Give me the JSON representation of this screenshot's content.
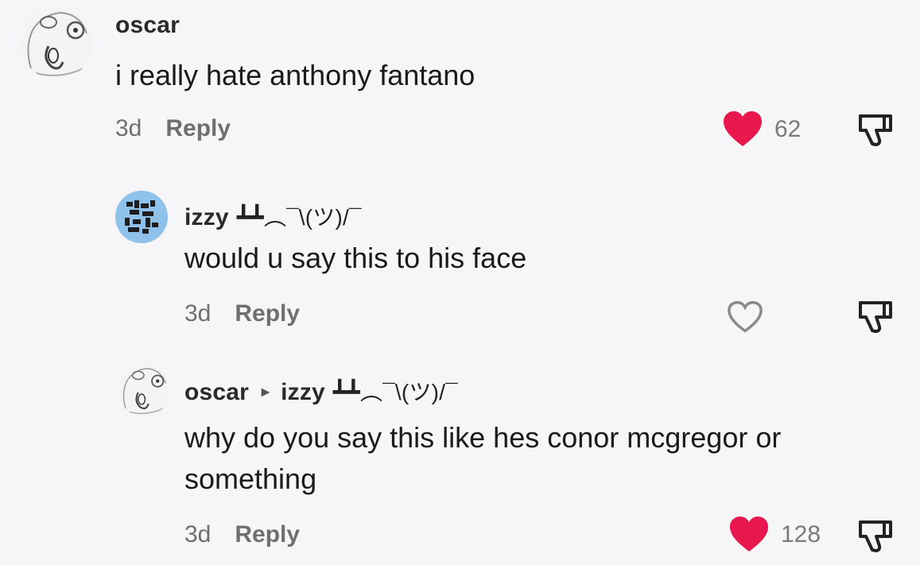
{
  "comments": [
    {
      "username": "oscar",
      "text": "i really hate anthony fantano",
      "time": "3d",
      "reply_label": "Reply",
      "liked": true,
      "like_count": "62"
    },
    {
      "username": "izzy",
      "username_suffix": "┻┻︵¯\\(ツ)/¯",
      "text": "would u say this to his face",
      "time": "3d",
      "reply_label": "Reply",
      "liked": false,
      "like_count": ""
    },
    {
      "username": "oscar",
      "reply_to": "izzy",
      "reply_to_suffix": "┻┻︵¯\\(ツ)/¯",
      "text_line1": "why do you say this like hes conor mcgregor or",
      "text_line2": "something",
      "time": "3d",
      "reply_label": "Reply",
      "liked": true,
      "like_count": "128"
    }
  ],
  "colors": {
    "heart_liked": "#e8174e",
    "heart_outline": "#8a8a8a",
    "background": "#f6f6f8"
  }
}
